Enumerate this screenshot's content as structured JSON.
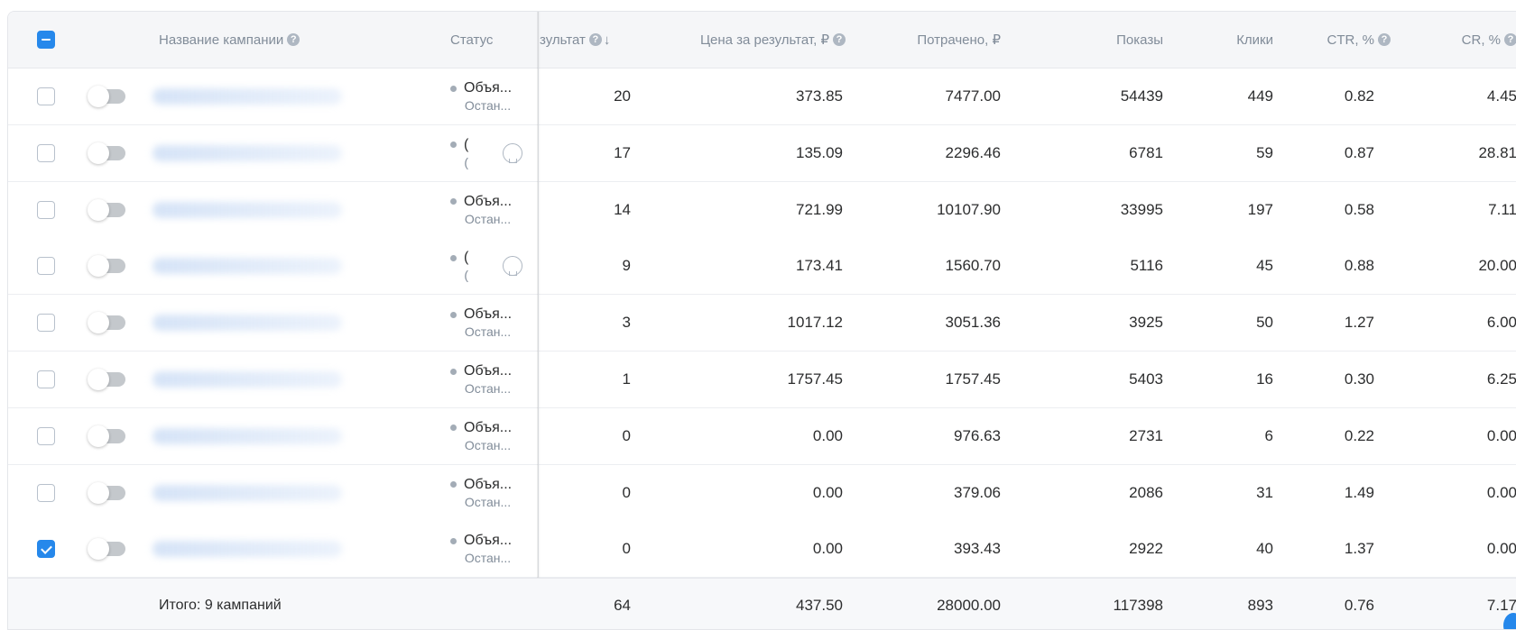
{
  "colors": {
    "accent": "#2688eb",
    "header_bg": "#f5f6f8",
    "muted": "#818c99"
  },
  "header": {
    "campaign_name": "Название кампании",
    "status": "Статус",
    "result": "зультат",
    "price_per_result": "Цена за результат, ₽",
    "spent": "Потрачено, ₽",
    "impressions": "Показы",
    "clicks": "Клики",
    "ctr": "CTR, %",
    "cr": "CR, %",
    "help_icon": "?",
    "sort_icon": "↓"
  },
  "rows": [
    {
      "checked": false,
      "status_main": "Объя...",
      "status_sub": "Остан...",
      "status_truncated": false,
      "result": "20",
      "price": "373.85",
      "spent": "7477.00",
      "impressions": "54439",
      "clicks": "449",
      "ctr": "0.82",
      "cr": "4.45"
    },
    {
      "checked": false,
      "status_main": "(",
      "status_sub": "(",
      "status_truncated": true,
      "result": "17",
      "price": "135.09",
      "spent": "2296.46",
      "impressions": "6781",
      "clicks": "59",
      "ctr": "0.87",
      "cr": "28.81"
    },
    {
      "checked": false,
      "status_main": "Объя...",
      "status_sub": "Остан...",
      "status_truncated": false,
      "result": "14",
      "price": "721.99",
      "spent": "10107.90",
      "impressions": "33995",
      "clicks": "197",
      "ctr": "0.58",
      "cr": "7.11"
    },
    {
      "checked": false,
      "status_main": "(",
      "status_sub": "(",
      "status_truncated": true,
      "result": "9",
      "price": "173.41",
      "spent": "1560.70",
      "impressions": "5116",
      "clicks": "45",
      "ctr": "0.88",
      "cr": "20.00"
    },
    {
      "checked": false,
      "status_main": "Объя...",
      "status_sub": "Остан...",
      "status_truncated": false,
      "result": "3",
      "price": "1017.12",
      "spent": "3051.36",
      "impressions": "3925",
      "clicks": "50",
      "ctr": "1.27",
      "cr": "6.00"
    },
    {
      "checked": false,
      "status_main": "Объя...",
      "status_sub": "Остан...",
      "status_truncated": false,
      "result": "1",
      "price": "1757.45",
      "spent": "1757.45",
      "impressions": "5403",
      "clicks": "16",
      "ctr": "0.30",
      "cr": "6.25"
    },
    {
      "checked": false,
      "status_main": "Объя...",
      "status_sub": "Остан...",
      "status_truncated": false,
      "result": "0",
      "price": "0.00",
      "spent": "976.63",
      "impressions": "2731",
      "clicks": "6",
      "ctr": "0.22",
      "cr": "0.00"
    },
    {
      "checked": false,
      "status_main": "Объя...",
      "status_sub": "Остан...",
      "status_truncated": false,
      "result": "0",
      "price": "0.00",
      "spent": "379.06",
      "impressions": "2086",
      "clicks": "31",
      "ctr": "1.49",
      "cr": "0.00"
    },
    {
      "checked": true,
      "status_main": "Объя...",
      "status_sub": "Остан...",
      "status_truncated": false,
      "result": "0",
      "price": "0.00",
      "spent": "393.43",
      "impressions": "2922",
      "clicks": "40",
      "ctr": "1.37",
      "cr": "0.00"
    }
  ],
  "footer": {
    "label": "Итого: 9 кампаний",
    "result": "64",
    "price": "437.50",
    "spent": "28000.00",
    "impressions": "117398",
    "clicks": "893",
    "ctr": "0.76",
    "cr": "7.17"
  }
}
